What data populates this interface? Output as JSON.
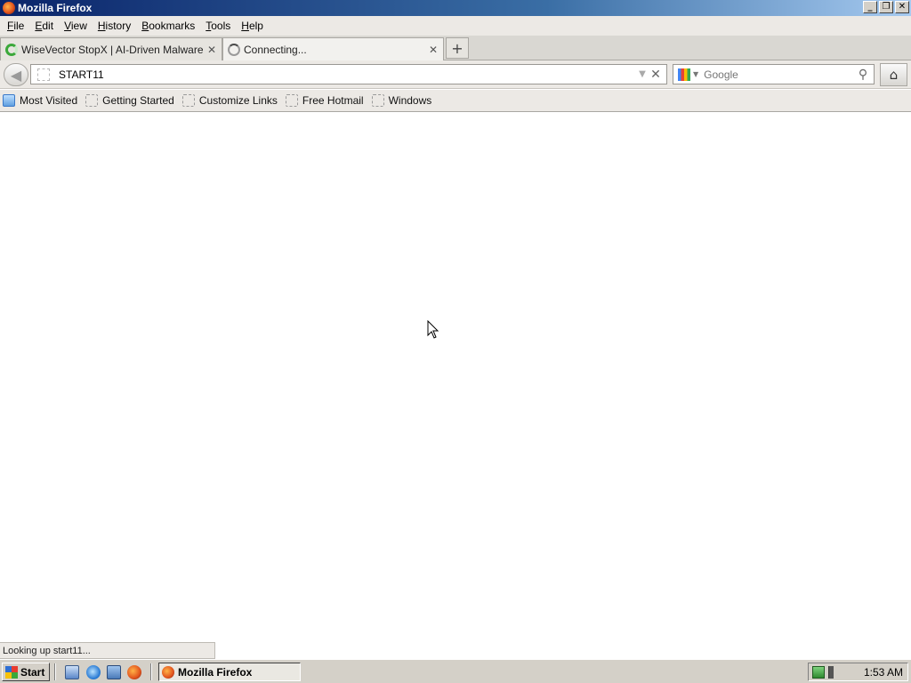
{
  "window": {
    "title": "Mozilla Firefox"
  },
  "menu": [
    "File",
    "Edit",
    "View",
    "History",
    "Bookmarks",
    "Tools",
    "Help"
  ],
  "tabs": [
    {
      "label": "WiseVector StopX | AI-Driven Malware D..."
    },
    {
      "label": "Connecting..."
    }
  ],
  "navbar": {
    "url": "START11",
    "search_placeholder": "Google"
  },
  "bookmarks": [
    "Most Visited",
    "Getting Started",
    "Customize Links",
    "Free Hotmail",
    "Windows"
  ],
  "status": {
    "text": "Looking up start11..."
  },
  "taskbar": {
    "start_label": "Start",
    "task_label": "Mozilla Firefox",
    "clock": "1:53 AM"
  },
  "icons": {
    "app": "firefox-icon",
    "back": "back-arrow-icon",
    "home": "home-icon",
    "search": "magnifier-icon"
  }
}
